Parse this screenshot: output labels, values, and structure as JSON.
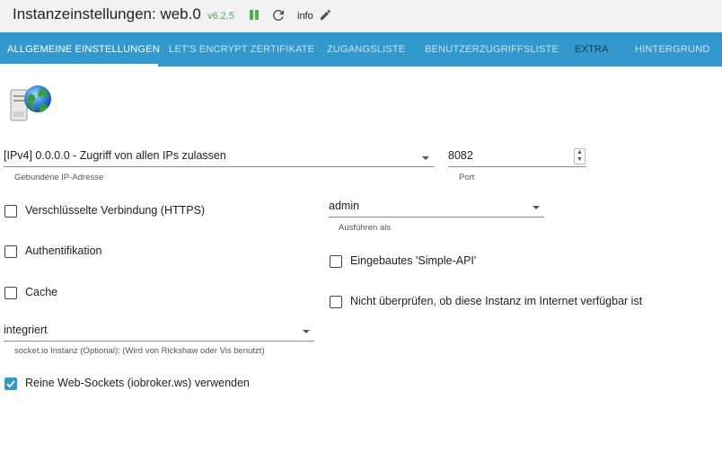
{
  "titlebar": {
    "title": "Instanzeinstellungen: web.0",
    "version": "v6.2.5",
    "info": "info"
  },
  "tabs": [
    {
      "label": "ALLGEMEINE EINSTELLUNGEN",
      "active": true
    },
    {
      "label": "LET'S ENCRYPT ZERTIFIKATE",
      "active": false
    },
    {
      "label": "ZUGANGSLISTE",
      "active": false
    },
    {
      "label": "BENUTZERZUGRIFFSLISTE",
      "active": false
    },
    {
      "label": "EXTRA",
      "active": false
    },
    {
      "label": "HINTERGRUND",
      "active": false
    }
  ],
  "form": {
    "bind": {
      "value": "[IPv4] 0.0.0.0 - Zugriff von allen IPs zulassen",
      "help": "Gebundene IP-Adresse"
    },
    "port": {
      "value": "8082",
      "help": "Port"
    },
    "run_as": {
      "value": "admin",
      "help": "Ausführen als"
    },
    "https": {
      "label": "Verschlüsselte Verbindung (HTTPS)",
      "checked": false
    },
    "auth": {
      "label": "Authentifikation",
      "checked": false
    },
    "cache": {
      "label": "Cache",
      "checked": false
    },
    "simple_api": {
      "label": "Eingebautes 'Simple-API'",
      "checked": false
    },
    "no_check": {
      "label": "Nicht überprüfen, ob diese Instanz im Internet verfügbar ist",
      "checked": false
    },
    "socketio": {
      "value": "integriert",
      "help": "socket.io Instanz (Optional): (Wird von Rickshaw oder Vis benutzt)"
    },
    "pure_ws": {
      "label": "Reine Web-Sockets (iobroker.ws) verwenden",
      "checked": true
    }
  },
  "colors": {
    "accent": "#3399cc",
    "running": "#4caf50"
  }
}
